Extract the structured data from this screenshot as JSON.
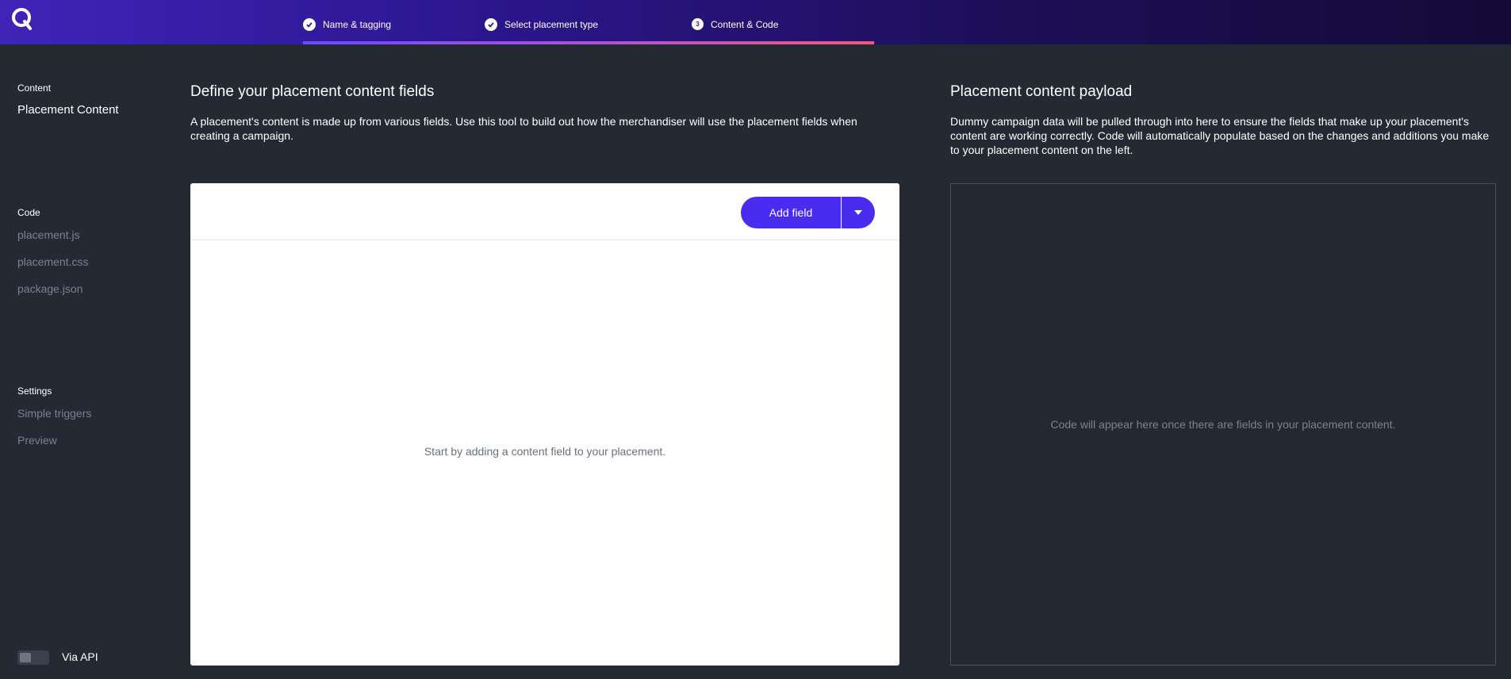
{
  "header": {
    "logo": "Q",
    "steps": [
      {
        "label": "Name & tagging",
        "state": "done",
        "icon": "check-icon"
      },
      {
        "label": "Select placement type",
        "state": "done",
        "icon": "check-icon"
      },
      {
        "label": "Content & Code",
        "state": "current",
        "number": "3"
      }
    ]
  },
  "sidebar": {
    "content_title": "Content",
    "content_items": [
      "Placement Content"
    ],
    "code_title": "Code",
    "code_items": [
      "placement.js",
      "placement.css",
      "package.json"
    ],
    "settings_title": "Settings",
    "settings_items": [
      "Simple triggers",
      "Preview"
    ],
    "api_toggle_label": "Via API"
  },
  "left_section": {
    "title": "Define your placement content fields",
    "description": "A placement's content is made up from various fields. Use this tool to build out how the merchandiser will use the placement fields when creating a campaign.",
    "add_field_label": "Add field",
    "empty_message": "Start by adding a content field to your placement."
  },
  "right_section": {
    "title": "Placement content payload",
    "description": "Dummy campaign data will be pulled through into here to ensure the fields that make up your placement's content are working correctly. Code will automatically populate based on the changes and additions you make to your placement content on the left.",
    "empty_message": "Code will appear here once there are fields in your placement content."
  },
  "colors": {
    "accent": "#4a2bf0",
    "background": "#232930",
    "header_start": "#3f24b8",
    "header_end": "#140a36"
  }
}
